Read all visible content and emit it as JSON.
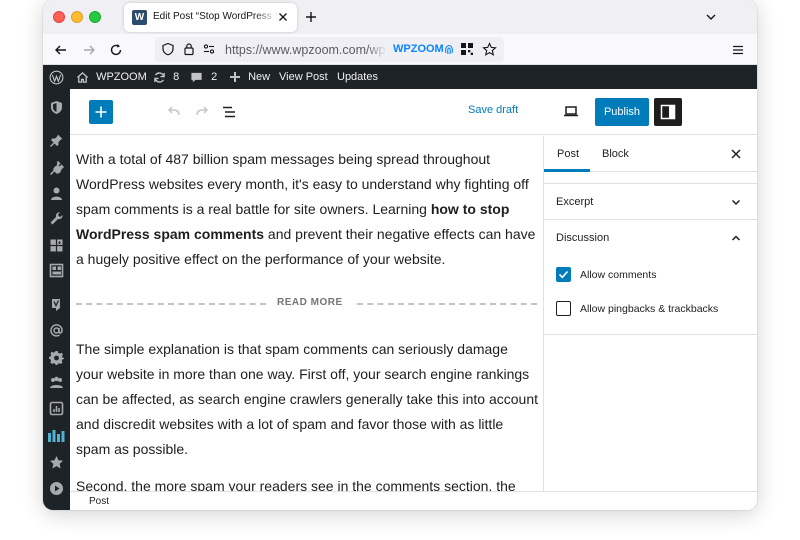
{
  "browser": {
    "tab_title": "Edit Post “Stop WordPress Spam",
    "favicon_letter": "W",
    "url": "https://www.wpzoom.com/wp-admin",
    "url_badge": "WPZOOM"
  },
  "adminbar": {
    "site_name": "WPZOOM",
    "updates_count": "8",
    "comments_count": "2",
    "new_label": "New",
    "view_post_label": "View Post",
    "updates_label": "Updates"
  },
  "sidebar_menu": {
    "icons": [
      "shield-icon",
      "pin-icon",
      "plugin-icon",
      "users-icon",
      "tools-icon",
      "blocks-icon",
      "layout-icon",
      "yoast-icon",
      "at-icon",
      "settings-icon",
      "people-icon",
      "chart-icon",
      "bars-icon",
      "star-icon",
      "play-icon"
    ]
  },
  "toolbar": {
    "save_draft_label": "Save draft",
    "publish_label": "Publish"
  },
  "content": {
    "paragraph_1_before": "With a total of 487 billion spam messages being spread throughout WordPress websites every month, it's easy to understand why fighting off spam comments is a real battle for site owners. Learning ",
    "paragraph_1_bold": "how to stop WordPress spam comments",
    "paragraph_1_after": " and prevent their negative effects can have a hugely positive effect on the performance of your website.",
    "read_more_label": "READ MORE",
    "paragraph_2": "The simple explanation is that spam comments can seriously damage your website in more than one way. First off, your search engine rankings can be affected, as search engine crawlers generally take this into account and discredit websites with a lot of spam and favor those with as little spam as possible.",
    "paragraph_3": "Second, the more spam your readers see in the comments section, the"
  },
  "settings_sidebar": {
    "tab_post": "Post",
    "tab_block": "Block",
    "excerpt_title": "Excerpt",
    "discussion_title": "Discussion",
    "allow_comments_label": "Allow comments",
    "allow_comments_checked": true,
    "allow_pingbacks_label": "Allow pingbacks & trackbacks",
    "allow_pingbacks_checked": false
  },
  "footer": {
    "breadcrumb": "Post"
  },
  "colors": {
    "accent": "#007cba",
    "admin_bar": "#1d2327",
    "text": "#1e1e1e"
  }
}
